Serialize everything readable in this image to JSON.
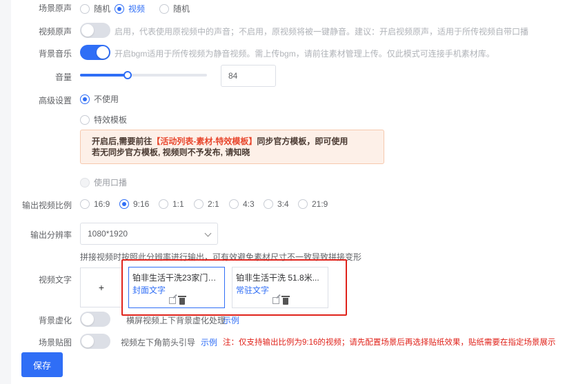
{
  "scene_mode": {
    "label": "场景原声",
    "options": [
      "随机",
      "视频",
      "随机"
    ],
    "selected": 1
  },
  "video_original_sound": {
    "label": "视频原声",
    "enabled": false,
    "hint": "启用，代表使用原视频中的声音；不启用，原视频将被一键静音。建议：开启视频原声，适用于所传视频自带口播"
  },
  "background_music": {
    "label": "背景音乐",
    "enabled": true,
    "hint": "开启bgm适用于所传视频为静音视频。需上传bgm，请前往素材管理上传。仅此模式可连接手机素材库。"
  },
  "volume": {
    "label": "音量",
    "value": "84",
    "level": 0.84
  },
  "advanced": {
    "label": "高级设置",
    "option_none": "不使用",
    "option_effect": "特效模板",
    "alert_prefix": "开启后,需要前往",
    "alert_link": "【活动列表-素材-特效模板】",
    "alert_suffix": "同步官方模板，即可使用",
    "alert_line2": "若无同步官方模板, 视频则不予发布, 请知晓",
    "option_voice": "使用口播"
  },
  "ratio": {
    "label": "输出视频比例",
    "options": [
      "16:9",
      "9:16",
      "1:1",
      "2:1",
      "4:3",
      "3:4",
      "21:9"
    ],
    "selected": 1
  },
  "resolution": {
    "label": "输出分辨率",
    "value": "1080*1920",
    "hint": "拼接视频时按照此分辨率进行输出，可有效避免素材尺寸不一致导致拼接变形"
  },
  "video_text": {
    "label": "视频文字",
    "add_symbol": "+",
    "cards": [
      {
        "title": "铂非生活干洗23家门店...",
        "type": "封面文字"
      },
      {
        "title": "铂非生活干洗 51.8米...",
        "type": "常驻文字"
      }
    ]
  },
  "background_blur": {
    "label": "背景虚化",
    "enabled": false,
    "hint": "横屏视频上下背景虚化处理",
    "link": "示例"
  },
  "scene_sticker": {
    "label": "场景贴图",
    "enabled": false,
    "hint": "视频左下角箭头引导",
    "link": "示例",
    "warning": "注：仅支持输出比例为9:16的视频；请先配置场景后再选择贴纸效果，贴纸需要在指定场景展示"
  },
  "save_button": "保存",
  "colors": {
    "primary": "#2f6ef6",
    "warning_red": "#e0231b",
    "alert_bg": "#fdf0e8"
  }
}
